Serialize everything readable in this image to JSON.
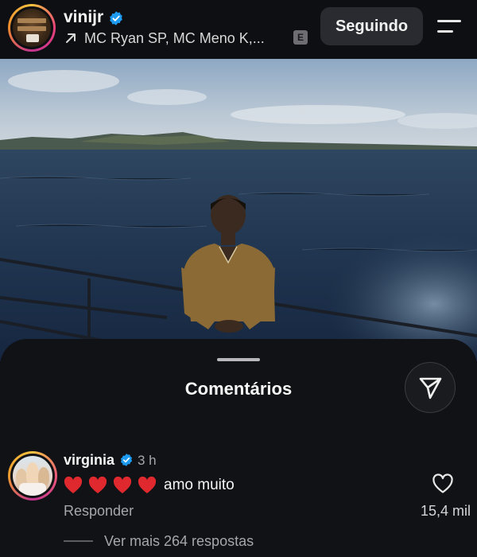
{
  "header": {
    "username": "vinijr",
    "verified_icon": "verified-badge-icon",
    "music": "MC Ryan SP, MC Meno K,...",
    "explicit_badge": "E",
    "follow_label": "Seguindo",
    "menu_icon": "hamburger-menu-icon"
  },
  "post": {
    "image": "man-on-boat-at-sea-photo"
  },
  "comments_sheet": {
    "title": "Comentários",
    "share_icon": "send-paper-plane-icon",
    "comment": {
      "author": "virginia",
      "time": "3 h",
      "hearts": [
        "❤️",
        "❤️",
        "❤️",
        "❤️"
      ],
      "text": "amo muito",
      "reply_label": "Responder",
      "like_count": "15,4 mil",
      "view_more": "Ver mais 264 respostas"
    }
  },
  "colors": {
    "accent_verified": "#1d9bf0",
    "heart": "#e0292f",
    "sheet_bg": "#111215"
  }
}
